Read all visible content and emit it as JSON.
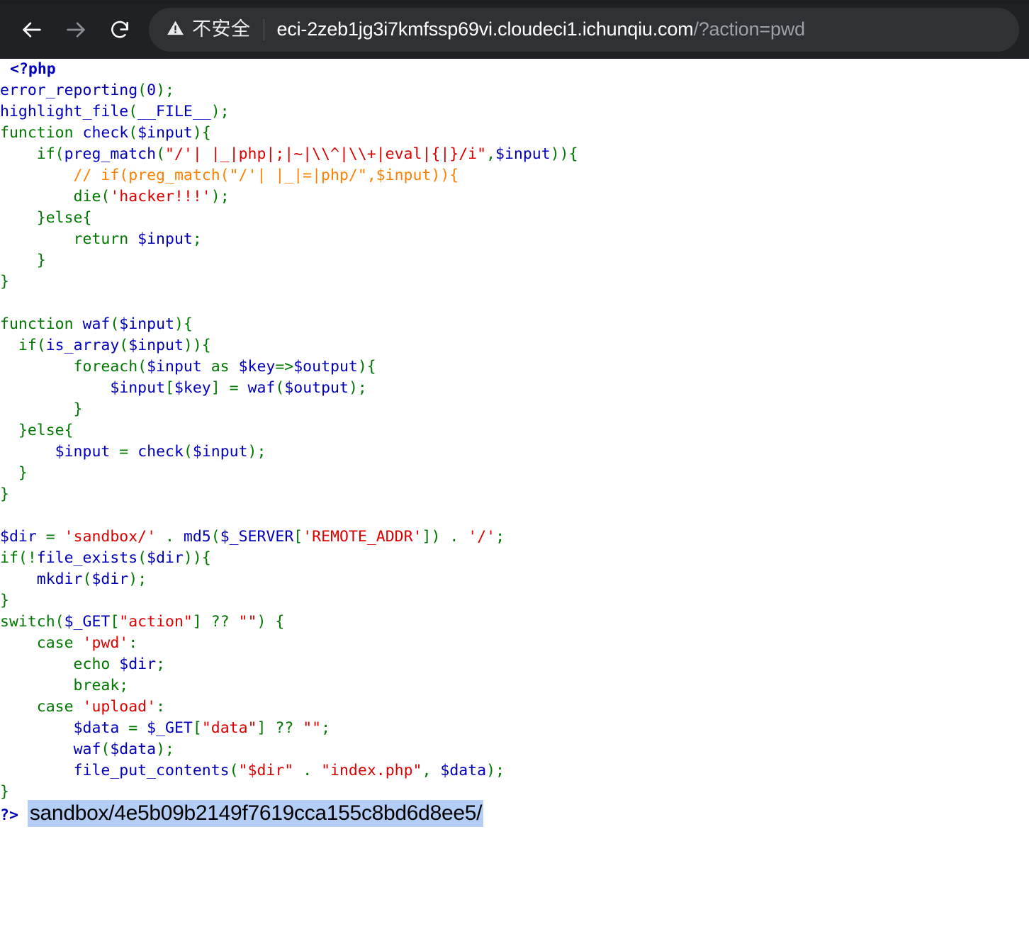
{
  "browser": {
    "back_icon": "arrow-left-icon",
    "forward_icon": "arrow-right-icon",
    "reload_icon": "reload-icon",
    "warning_icon": "warning-triangle-icon",
    "security_label": "不安全",
    "url_host": "eci-2zeb1jg3i7kmfssp69vi.cloudeci1.ichunqiu.com",
    "url_path": "/?action=pwd",
    "full_url": "eci-2zeb1jg3i7kmfssp69vi.cloudeci1.ichunqiu.com/?action=pwd",
    "toolbar_bg": "#202124",
    "omnibox_bg": "#303134"
  },
  "code": {
    "language": "php",
    "colors": {
      "tag": "#0000BB",
      "default": "#0000BB",
      "keyword": "#007700",
      "string": "#DD0000",
      "comment": "#FF8000",
      "background": "#FFFFFF"
    },
    "lines": [
      {
        "tokens": [
          {
            "t": "<?php",
            "c": "tag"
          }
        ]
      },
      {
        "tokens": [
          {
            "t": "error_reporting",
            "c": "default"
          },
          {
            "t": "(",
            "c": "keyword"
          },
          {
            "t": "0",
            "c": "default"
          },
          {
            "t": ");",
            "c": "keyword"
          }
        ]
      },
      {
        "tokens": [
          {
            "t": "highlight_file",
            "c": "default"
          },
          {
            "t": "(",
            "c": "keyword"
          },
          {
            "t": "__FILE__",
            "c": "default"
          },
          {
            "t": ");",
            "c": "keyword"
          }
        ]
      },
      {
        "tokens": [
          {
            "t": "function ",
            "c": "keyword"
          },
          {
            "t": "check",
            "c": "default"
          },
          {
            "t": "(",
            "c": "keyword"
          },
          {
            "t": "$input",
            "c": "default"
          },
          {
            "t": "){",
            "c": "keyword"
          }
        ]
      },
      {
        "tokens": [
          {
            "t": "    if(",
            "c": "keyword"
          },
          {
            "t": "preg_match",
            "c": "default"
          },
          {
            "t": "(",
            "c": "keyword"
          },
          {
            "t": "\"/'| |_|php|;|~|\\\\^|\\\\+|eval|{|}/i\"",
            "c": "string"
          },
          {
            "t": ",",
            "c": "keyword"
          },
          {
            "t": "$input",
            "c": "default"
          },
          {
            "t": ")){",
            "c": "keyword"
          }
        ]
      },
      {
        "tokens": [
          {
            "t": "        // if(preg_match(\"/'| |_|=|php/\",$input)){",
            "c": "comment"
          }
        ]
      },
      {
        "tokens": [
          {
            "t": "        ",
            "c": "keyword"
          },
          {
            "t": "die",
            "c": "keyword"
          },
          {
            "t": "(",
            "c": "keyword"
          },
          {
            "t": "'hacker!!!'",
            "c": "string"
          },
          {
            "t": ");",
            "c": "keyword"
          }
        ]
      },
      {
        "tokens": [
          {
            "t": "    }else{",
            "c": "keyword"
          }
        ]
      },
      {
        "tokens": [
          {
            "t": "        return ",
            "c": "keyword"
          },
          {
            "t": "$input",
            "c": "default"
          },
          {
            "t": ";",
            "c": "keyword"
          }
        ]
      },
      {
        "tokens": [
          {
            "t": "    }",
            "c": "keyword"
          }
        ]
      },
      {
        "tokens": [
          {
            "t": "}",
            "c": "keyword"
          }
        ]
      },
      {
        "tokens": []
      },
      {
        "tokens": [
          {
            "t": "function ",
            "c": "keyword"
          },
          {
            "t": "waf",
            "c": "default"
          },
          {
            "t": "(",
            "c": "keyword"
          },
          {
            "t": "$input",
            "c": "default"
          },
          {
            "t": "){",
            "c": "keyword"
          }
        ]
      },
      {
        "tokens": [
          {
            "t": "  if(",
            "c": "keyword"
          },
          {
            "t": "is_array",
            "c": "default"
          },
          {
            "t": "(",
            "c": "keyword"
          },
          {
            "t": "$input",
            "c": "default"
          },
          {
            "t": ")){",
            "c": "keyword"
          }
        ]
      },
      {
        "tokens": [
          {
            "t": "        foreach(",
            "c": "keyword"
          },
          {
            "t": "$input",
            "c": "default"
          },
          {
            "t": " as ",
            "c": "keyword"
          },
          {
            "t": "$key",
            "c": "default"
          },
          {
            "t": "=>",
            "c": "keyword"
          },
          {
            "t": "$output",
            "c": "default"
          },
          {
            "t": "){",
            "c": "keyword"
          }
        ]
      },
      {
        "tokens": [
          {
            "t": "            ",
            "c": "keyword"
          },
          {
            "t": "$input",
            "c": "default"
          },
          {
            "t": "[",
            "c": "keyword"
          },
          {
            "t": "$key",
            "c": "default"
          },
          {
            "t": "] = ",
            "c": "keyword"
          },
          {
            "t": "waf",
            "c": "default"
          },
          {
            "t": "(",
            "c": "keyword"
          },
          {
            "t": "$output",
            "c": "default"
          },
          {
            "t": ");",
            "c": "keyword"
          }
        ]
      },
      {
        "tokens": [
          {
            "t": "        }",
            "c": "keyword"
          }
        ]
      },
      {
        "tokens": [
          {
            "t": "  }else{",
            "c": "keyword"
          }
        ]
      },
      {
        "tokens": [
          {
            "t": "      ",
            "c": "keyword"
          },
          {
            "t": "$input",
            "c": "default"
          },
          {
            "t": " = ",
            "c": "keyword"
          },
          {
            "t": "check",
            "c": "default"
          },
          {
            "t": "(",
            "c": "keyword"
          },
          {
            "t": "$input",
            "c": "default"
          },
          {
            "t": ");",
            "c": "keyword"
          }
        ]
      },
      {
        "tokens": [
          {
            "t": "  }",
            "c": "keyword"
          }
        ]
      },
      {
        "tokens": [
          {
            "t": "}",
            "c": "keyword"
          }
        ]
      },
      {
        "tokens": []
      },
      {
        "tokens": [
          {
            "t": "$dir",
            "c": "default"
          },
          {
            "t": " = ",
            "c": "keyword"
          },
          {
            "t": "'sandbox/'",
            "c": "string"
          },
          {
            "t": " . ",
            "c": "keyword"
          },
          {
            "t": "md5",
            "c": "default"
          },
          {
            "t": "(",
            "c": "keyword"
          },
          {
            "t": "$_SERVER",
            "c": "default"
          },
          {
            "t": "[",
            "c": "keyword"
          },
          {
            "t": "'REMOTE_ADDR'",
            "c": "string"
          },
          {
            "t": "]) . ",
            "c": "keyword"
          },
          {
            "t": "'/'",
            "c": "string"
          },
          {
            "t": ";",
            "c": "keyword"
          }
        ]
      },
      {
        "tokens": [
          {
            "t": "if(!",
            "c": "keyword"
          },
          {
            "t": "file_exists",
            "c": "default"
          },
          {
            "t": "(",
            "c": "keyword"
          },
          {
            "t": "$dir",
            "c": "default"
          },
          {
            "t": ")){",
            "c": "keyword"
          }
        ]
      },
      {
        "tokens": [
          {
            "t": "    ",
            "c": "keyword"
          },
          {
            "t": "mkdir",
            "c": "default"
          },
          {
            "t": "(",
            "c": "keyword"
          },
          {
            "t": "$dir",
            "c": "default"
          },
          {
            "t": ");",
            "c": "keyword"
          }
        ]
      },
      {
        "tokens": [
          {
            "t": "}",
            "c": "keyword"
          }
        ]
      },
      {
        "tokens": [
          {
            "t": "switch(",
            "c": "keyword"
          },
          {
            "t": "$_GET",
            "c": "default"
          },
          {
            "t": "[",
            "c": "keyword"
          },
          {
            "t": "\"action\"",
            "c": "string"
          },
          {
            "t": "] ?? ",
            "c": "keyword"
          },
          {
            "t": "\"\"",
            "c": "string"
          },
          {
            "t": ") {",
            "c": "keyword"
          }
        ]
      },
      {
        "tokens": [
          {
            "t": "    case ",
            "c": "keyword"
          },
          {
            "t": "'pwd'",
            "c": "string"
          },
          {
            "t": ":",
            "c": "keyword"
          }
        ]
      },
      {
        "tokens": [
          {
            "t": "        echo ",
            "c": "keyword"
          },
          {
            "t": "$dir",
            "c": "default"
          },
          {
            "t": ";",
            "c": "keyword"
          }
        ]
      },
      {
        "tokens": [
          {
            "t": "        break;",
            "c": "keyword"
          }
        ]
      },
      {
        "tokens": [
          {
            "t": "    case ",
            "c": "keyword"
          },
          {
            "t": "'upload'",
            "c": "string"
          },
          {
            "t": ":",
            "c": "keyword"
          }
        ]
      },
      {
        "tokens": [
          {
            "t": "        ",
            "c": "keyword"
          },
          {
            "t": "$data",
            "c": "default"
          },
          {
            "t": " = ",
            "c": "keyword"
          },
          {
            "t": "$_GET",
            "c": "default"
          },
          {
            "t": "[",
            "c": "keyword"
          },
          {
            "t": "\"data\"",
            "c": "string"
          },
          {
            "t": "] ?? ",
            "c": "keyword"
          },
          {
            "t": "\"\"",
            "c": "string"
          },
          {
            "t": ";",
            "c": "keyword"
          }
        ]
      },
      {
        "tokens": [
          {
            "t": "        ",
            "c": "keyword"
          },
          {
            "t": "waf",
            "c": "default"
          },
          {
            "t": "(",
            "c": "keyword"
          },
          {
            "t": "$data",
            "c": "default"
          },
          {
            "t": ");",
            "c": "keyword"
          }
        ]
      },
      {
        "tokens": [
          {
            "t": "        ",
            "c": "keyword"
          },
          {
            "t": "file_put_contents",
            "c": "default"
          },
          {
            "t": "(",
            "c": "keyword"
          },
          {
            "t": "\"$dir\"",
            "c": "string"
          },
          {
            "t": " . ",
            "c": "keyword"
          },
          {
            "t": "\"index.php\"",
            "c": "string"
          },
          {
            "t": ", ",
            "c": "keyword"
          },
          {
            "t": "$data",
            "c": "default"
          },
          {
            "t": ");",
            "c": "keyword"
          }
        ]
      },
      {
        "tokens": [
          {
            "t": "}",
            "c": "keyword"
          }
        ]
      }
    ],
    "close_tag": "?>"
  },
  "output": {
    "text": "sandbox/4e5b09b2149f7619cca155c8bd6d8ee5/",
    "md5": "4e5b09b2149f7619cca155c8bd6d8ee5",
    "prefix": "sandbox/",
    "selection_color": "#b3cdf4",
    "selected": true
  }
}
